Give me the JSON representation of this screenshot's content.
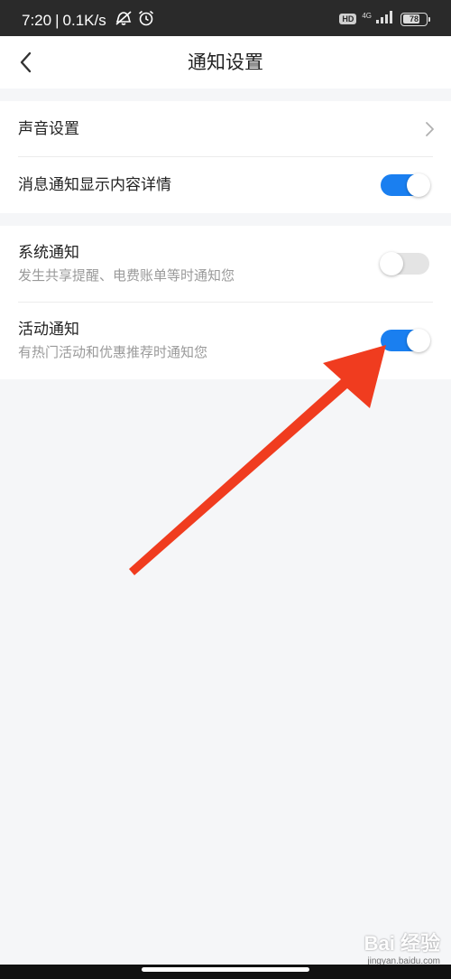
{
  "status_bar": {
    "time": "7:20",
    "separator": "|",
    "net_speed": "0.1K/s",
    "hd_badge": "HD",
    "network_type": "4G",
    "battery": "78",
    "battery_level": 0.78,
    "icons": [
      "mute-icon",
      "alarm-icon",
      "signal-icon",
      "battery-icon"
    ]
  },
  "nav": {
    "back_icon": "chevron-left-icon",
    "title": "通知设置"
  },
  "settings": {
    "sound": {
      "label": "声音设置",
      "icon": "chevron-right-icon"
    },
    "detail": {
      "label": "消息通知显示内容详情",
      "enabled": true
    },
    "system": {
      "label": "系统通知",
      "desc": "发生共享提醒、电费账单等时通知您",
      "enabled": false
    },
    "activity": {
      "label": "活动通知",
      "desc": "有热门活动和优惠推荐时通知您",
      "enabled": true
    }
  },
  "colors": {
    "accent": "#1a7ff0",
    "toggle_off": "#e4e4e4",
    "annotation_arrow": "#f03c1f"
  },
  "watermark": {
    "logo": "Bai 经验",
    "url": "jingyan.baidu.com"
  }
}
